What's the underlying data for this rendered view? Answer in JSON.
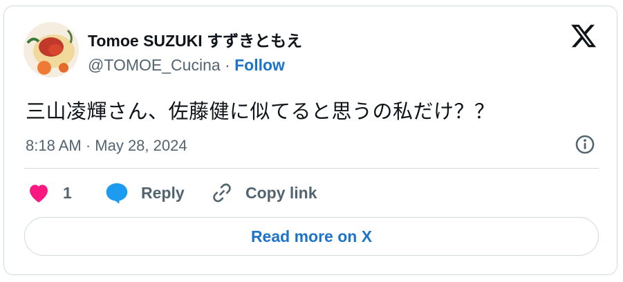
{
  "tweet": {
    "author_name": "Tomoe SUZUKI すずきともえ",
    "author_handle": "@TOMOE_Cucina",
    "separator": " · ",
    "follow_label": "Follow",
    "text": "三山凌輝さん、佐藤健に似てると思うの私だけ？？",
    "timestamp": "8:18 AM · May 28, 2024"
  },
  "actions": {
    "like_count": "1",
    "reply_label": "Reply",
    "copy_link_label": "Copy link"
  },
  "read_more_label": "Read more on X",
  "icons": {
    "like": "heart-icon",
    "reply": "speech-bubble-icon",
    "copy": "link-icon",
    "info": "info-icon",
    "brand": "x-logo-icon"
  },
  "colors": {
    "heart": "#f91880",
    "reply": "#1d9bf0",
    "link_blue": "#1d73c9",
    "muted_text": "#536471",
    "border": "#cfd9de"
  }
}
